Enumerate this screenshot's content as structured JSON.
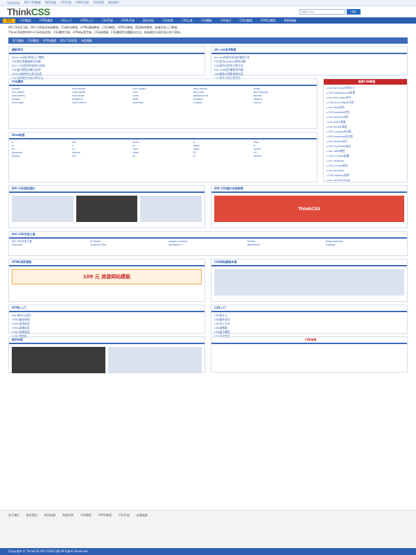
{
  "top": {
    "links": [
      "ThinkCSS",
      "DIV CSS教程",
      "网页布局",
      "CSS手册",
      "HTML手册",
      "CSS实例",
      "联系我们"
    ]
  },
  "brand": {
    "logo_main": "Think",
    "logo_accent": "CSS",
    "search_placeholder": "搜索DIV CSS",
    "search_btn": "搜索"
  },
  "nav": [
    "首页",
    "CSS教程",
    "HTML教程",
    "CSS入门",
    "HTML入门",
    "CSS手册",
    "HTML手册",
    "网页布局",
    "CSS实例",
    "CSS工具",
    "CSS模板",
    "CSS技巧",
    "CSS3教程",
    "HTML5教程",
    "WEB前端"
  ],
  "intro": {
    "p1": "DIV CSS学习网，DIV CSS网页布局教程，CSS样式教程，HTML基础教程，CSS3教程，HTML5教程，网页制作教程，前端开发入门教程。",
    "p2": "ThinkCSS提供DIV+CSS布局实例，CSS属性手册，HTML标签手册，CSS选择器，CSS兼容性问题解决方法，网站建设与网页设计学习资料。"
  },
  "subnav": [
    "学习指南",
    "CSS教程",
    "HTML教程",
    "DIV CSS实例",
    "布局模板"
  ],
  "panels": {
    "news_title": "最新资讯",
    "news": [
      "Html css网页布局入门教程",
      "CSS样式表基础知识详解",
      "DIV+CSS网页布局技巧总结",
      "CSS盒子模型详解与实例",
      "HTML5新特性与语义标签",
      "CSS选择器优先级计算方法"
    ],
    "tips_title": "div css技术教程",
    "tips": [
      "div css布局中浮动的清除方法",
      "CSS定位position属性详解",
      "CSS居中对齐的几种方法",
      "DIV CSS网页兼容性问题",
      "CSS圆角与阴影效果实现",
      "CSS伪类与伪元素用法"
    ]
  },
  "sidebar": {
    "title": "推荐CSS教程",
    "items": [
      "css font-size字体大小",
      "CSS background背景",
      "css text-align对齐",
      "CSS line-height行高",
      "css float浮动",
      "CSS position定位",
      "CSS border边框",
      "css width宽度",
      "css height高度",
      "CSS margin外边距",
      "CSS padding内边距",
      "css display显示",
      "CSS overflow溢出",
      "css color颜色",
      "CSS z-index层叠",
      "css visibility",
      "CSS cursor鼠标",
      "css list-style",
      "CSS opacity透明",
      "css vertical-align"
    ]
  },
  "css_props": {
    "title": "CSS属性",
    "items": [
      "height",
      "line-height",
      "min-height",
      "max-height",
      "width",
      "min-width",
      "max-width",
      "font",
      "font-size",
      "font-weight",
      "font-family",
      "font-style",
      "color",
      "background",
      "border",
      "margin",
      "padding",
      "float",
      "position",
      "display",
      "text-align",
      "text-indent",
      "overflow",
      "z-index",
      "cursor"
    ]
  },
  "html_tags": {
    "title": "Html标签",
    "items": [
      "a",
      "div",
      "span",
      "p",
      "img",
      "ul",
      "li",
      "ol",
      "table",
      "tr",
      "td",
      "th",
      "form",
      "input",
      "select",
      "textarea",
      "button",
      "label",
      "h1",
      "h2",
      "strong",
      "em",
      "br",
      "hr",
      "iframe"
    ]
  },
  "examples": {
    "title": "DIV CSS网页图片",
    "banner_text": "ThinkCSS",
    "captions": [
      "CSS网页图片列表实例",
      "DIV CSS图片布局效果"
    ]
  },
  "tools": {
    "title": "DIV CSS开发工具",
    "items": [
      "DIV CSS开发工具",
      "IE Tester",
      "google chrome",
      "Firefox",
      "Dreamweaver",
      "HBuilder",
      "Sublime Text",
      "Notepad++",
      "WebStorm",
      "FireBug"
    ]
  },
  "templates": {
    "title": "HTML网页模板",
    "promo": "109 元 旅游网站模板",
    "captions": [
      "html网页模板下载",
      "CSS网站模板布局"
    ]
  },
  "html_intro": {
    "title": "HTML入门",
    "items": [
      "html是什么语言",
      "HTML基本结构",
      "HTML常用标签",
      "HTML表格标签",
      "HTML表单标签",
      "HTML超链接"
    ]
  },
  "css_intro": {
    "title": "CSS入门",
    "items": [
      "CSS是什么",
      "CSS基本语法",
      "CSS引入方式",
      "CSS选择器",
      "CSS盒子模型",
      "CSS浮动定位"
    ]
  },
  "layout": {
    "title": "网页布局",
    "table_title": "CSS布局"
  },
  "footer": {
    "links": [
      "关于我们",
      "联系我们",
      "网站地图",
      "免责声明",
      "CSS教程",
      "HTML教程",
      "CSS手册",
      "友情链接"
    ],
    "copyright": "Copyright © ThinkCSS DIV CSS学习网 All Rights Reserved"
  },
  "colors": {
    "brand": "#2e7d32",
    "nav": "#2d5fb3",
    "accent": "#ffb300",
    "sidebar_head": "#c62828"
  }
}
